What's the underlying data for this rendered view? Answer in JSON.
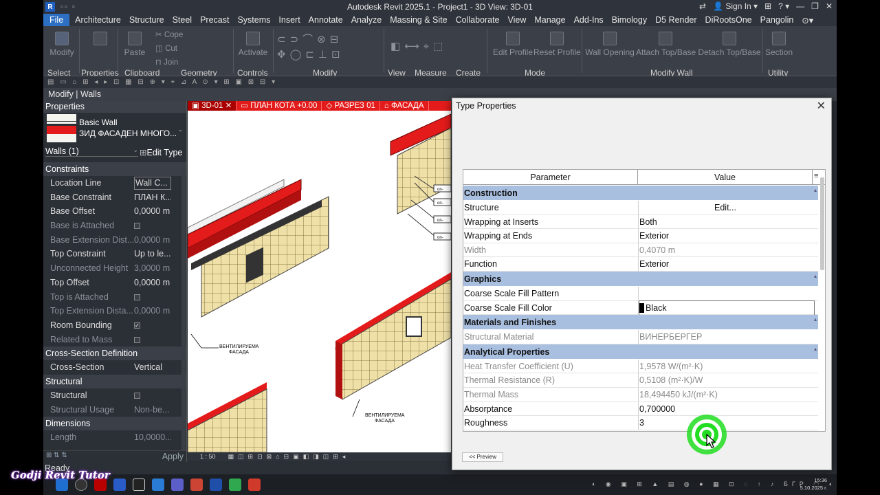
{
  "window": {
    "title": "Autodesk Revit 2025.1 - Project1 - 3D View: 3D-01",
    "sign_in": "Sign In"
  },
  "menu": {
    "items": [
      "File",
      "Architecture",
      "Structure",
      "Steel",
      "Precast",
      "Systems",
      "Insert",
      "Annotate",
      "Analyze",
      "Massing & Site",
      "Collaborate",
      "View",
      "Manage",
      "Add-Ins",
      "Bimology",
      "D5 Render",
      "DiRootsOne",
      "Pangolin"
    ]
  },
  "ribbon": {
    "buttons": {
      "modify": "Modify",
      "paste": "Paste",
      "cope": "Cope",
      "cut": "Cut",
      "join": "Join",
      "activate": "Activate",
      "edit_profile": "Edit Profile",
      "reset_profile": "Reset Profile",
      "wall_opening": "Wall Opening",
      "attach_top_base": "Attach Top/Base",
      "detach_top_base": "Detach Top/Base",
      "section": "Section"
    },
    "panels": {
      "select": "Select",
      "properties": "Properties",
      "clipboard": "Clipboard",
      "geometry": "Geometry",
      "controls": "Controls",
      "modify": "Modify",
      "view": "View",
      "measure": "Measure",
      "create": "Create",
      "mode": "Mode",
      "modify_wall": "Modify Wall",
      "utility": "Utility"
    }
  },
  "context_bar": "Modify | Walls",
  "properties": {
    "title": "Properties",
    "type_family": "Basic Wall",
    "type_name": "ЗИД ФАСАДЕН МНОГО...",
    "instance_selector": "Walls (1)",
    "edit_type": "Edit Type",
    "groups": {
      "constraints": "Constraints",
      "cross_section": "Cross-Section Definition",
      "structural": "Structural",
      "dimensions": "Dimensions"
    },
    "constraints": [
      {
        "name": "Location Line",
        "value": "Wall C..."
      },
      {
        "name": "Base Constraint",
        "value": "ПЛАН К..."
      },
      {
        "name": "Base Offset",
        "value": "0,0000 m"
      },
      {
        "name": "Base is Attached",
        "value": ""
      },
      {
        "name": "Base Extension Dist...",
        "value": "0,0000 m"
      },
      {
        "name": "Top Constraint",
        "value": "Up to le..."
      },
      {
        "name": "Unconnected Height",
        "value": "3,0000 m"
      },
      {
        "name": "Top Offset",
        "value": "0,0000 m"
      },
      {
        "name": "Top is Attached",
        "value": ""
      },
      {
        "name": "Top Extension Dista...",
        "value": "0,0000 m"
      },
      {
        "name": "Room Bounding",
        "value": ""
      },
      {
        "name": "Related to Mass",
        "value": ""
      }
    ],
    "cross_section": [
      {
        "name": "Cross-Section",
        "value": "Vertical"
      }
    ],
    "structural": [
      {
        "name": "Structural",
        "value": ""
      },
      {
        "name": "Structural Usage",
        "value": "Non-be..."
      }
    ],
    "dimensions": [
      {
        "name": "Length",
        "value": "10,0000..."
      }
    ],
    "apply": "Apply"
  },
  "view_tabs": [
    "3D-01",
    "ПЛАН КОТА +0.00",
    "РАЗРЕЗ 01",
    "ФАСАДА"
  ],
  "canvas": {
    "label1": "ВЕНТИЛИРУЕМА\nФАСАДА",
    "label2": "ВЕНТИЛИРУЕМА\nФАСАДА",
    "tag": "оп-"
  },
  "view_control": {
    "scale": "1 : 50"
  },
  "status": "Ready",
  "dialog": {
    "title": "Type Properties",
    "col_parameter": "Parameter",
    "col_value": "Value",
    "rows": [
      {
        "type": "group",
        "name": "Construction"
      },
      {
        "name": "Structure",
        "value": "Edit...",
        "center": true
      },
      {
        "name": "Wrapping at Inserts",
        "value": "Both"
      },
      {
        "name": "Wrapping at Ends",
        "value": "Exterior"
      },
      {
        "name": "Width",
        "value": "0,4070 m",
        "dim": true
      },
      {
        "name": "Function",
        "value": "Exterior"
      },
      {
        "type": "group",
        "name": "Graphics"
      },
      {
        "name": "Coarse Scale Fill Pattern",
        "value": ""
      },
      {
        "name": "Coarse Scale Fill Color",
        "value": "Black",
        "swatch": "#000000",
        "selected": true
      },
      {
        "type": "group",
        "name": "Materials and Finishes"
      },
      {
        "name": "Structural Material",
        "value": "ВИНЕРБЕРГЕР",
        "dim": true
      },
      {
        "type": "group",
        "name": "Analytical Properties"
      },
      {
        "name": "Heat Transfer Coefficient (U)",
        "value": "1,9578 W/(m²·K)",
        "dim": true
      },
      {
        "name": "Thermal Resistance (R)",
        "value": "0,5108 (m²·K)/W",
        "dim": true
      },
      {
        "name": "Thermal Mass",
        "value": "18,494450 kJ/(m²·K)",
        "dim": true
      },
      {
        "name": "Absorptance",
        "value": "0,700000"
      },
      {
        "name": "Roughness",
        "value": "3"
      }
    ],
    "preview_button": "<< Preview"
  },
  "taskbar": {
    "time": "15:36",
    "date": "5.10.2025 г.",
    "lang": "БГР"
  },
  "watermark": "Godji Revit Tutor",
  "colors": {
    "accent_file": "#2d6fc2",
    "view_tab_red": "#e31b1b",
    "group_row": "#a9bfe0",
    "cursor_green": "#22dd22"
  }
}
